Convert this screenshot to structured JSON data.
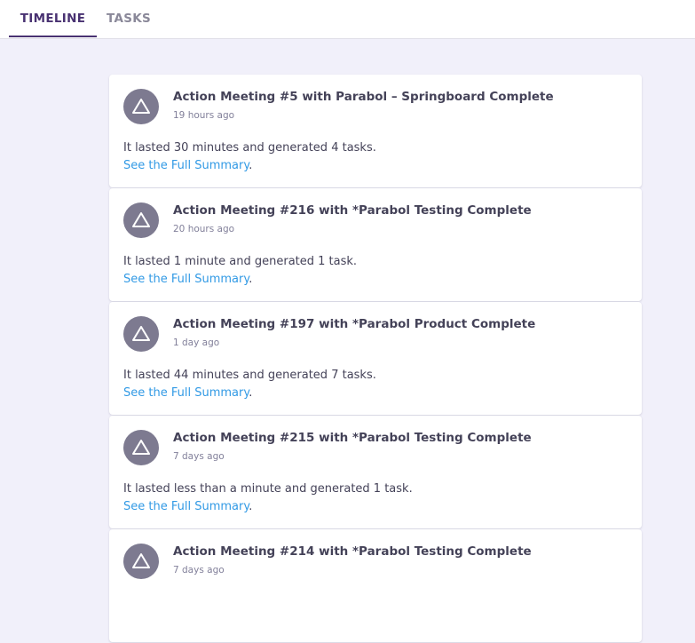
{
  "tabs": [
    {
      "label": "TIMELINE",
      "active": true
    },
    {
      "label": "TASKS",
      "active": false
    }
  ],
  "link_label": "See the Full Summary",
  "link_suffix": ".",
  "events": [
    {
      "title": "Action Meeting #5 with Parabol – Springboard Complete",
      "time": "19 hours ago",
      "summary": "It lasted 30 minutes and generated 4 tasks."
    },
    {
      "title": "Action Meeting #216 with *Parabol Testing Complete",
      "time": "20 hours ago",
      "summary": "It lasted 1 minute and generated 1 task."
    },
    {
      "title": "Action Meeting #197 with *Parabol Product Complete",
      "time": "1 day ago",
      "summary": "It lasted 44 minutes and generated 7 tasks."
    },
    {
      "title": "Action Meeting #215 with *Parabol Testing Complete",
      "time": "7 days ago",
      "summary": "It lasted less than a minute and generated 1 task."
    },
    {
      "title": "Action Meeting #214 with *Parabol Testing Complete",
      "time": "7 days ago",
      "summary": ""
    }
  ],
  "icon": "triangle-icon",
  "colors": {
    "accent": "#493272",
    "link": "#329ae5",
    "avatar": "#7d7a90",
    "background": "#f1f0fa"
  }
}
